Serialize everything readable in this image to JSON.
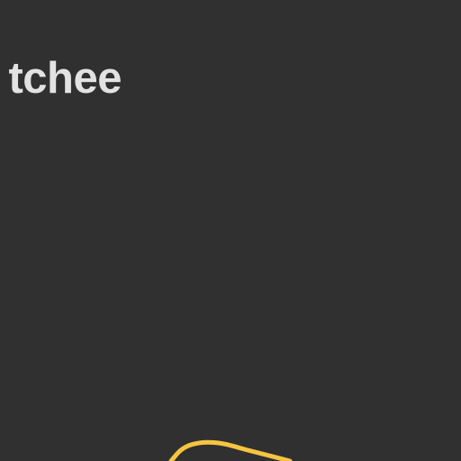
{
  "map": {
    "background_color": "#303030",
    "place_label": "tchee",
    "label_color": "#e2e2e2",
    "road": {
      "type": "major-road",
      "color": "#f5c542"
    }
  }
}
